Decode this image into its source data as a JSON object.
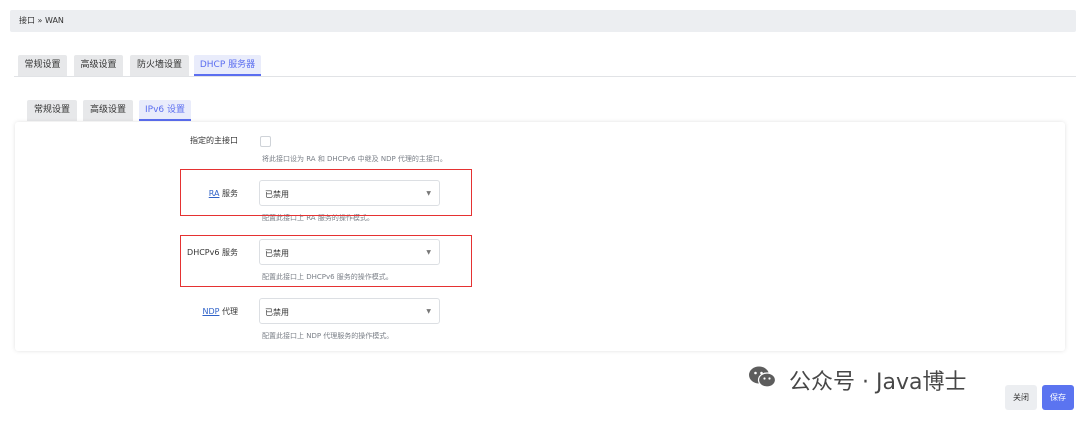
{
  "breadcrumb": "接口 » WAN",
  "main_tabs": [
    {
      "label": "常规设置",
      "active": false
    },
    {
      "label": "高级设置",
      "active": false
    },
    {
      "label": "防火墙设置",
      "active": false
    },
    {
      "label": "DHCP 服务器",
      "active": true
    }
  ],
  "sub_tabs": [
    {
      "label": "常规设置",
      "active": false
    },
    {
      "label": "高级设置",
      "active": false
    },
    {
      "label": "IPv6 设置",
      "active": true
    }
  ],
  "fields": {
    "master": {
      "label": "指定的主接口",
      "desc": "将此接口设为 RA 和 DHCPv6 中继及 NDP 代理的主接口。",
      "checked": false
    },
    "ra": {
      "label_abbr": "RA",
      "label_rest": " 服务",
      "value": "已禁用",
      "desc": "配置此接口上 RA 服务的操作模式。"
    },
    "dhcpv6": {
      "label": "DHCPv6 服务",
      "value": "已禁用",
      "desc": "配置此接口上 DHCPv6 服务的操作模式。"
    },
    "ndp": {
      "label_abbr": "NDP",
      "label_rest": " 代理",
      "value": "已禁用",
      "desc": "配置此接口上 NDP 代理服务的操作模式。"
    }
  },
  "watermark": "公众号 · Java博士",
  "buttons": {
    "close": "关闭",
    "save": "保存"
  },
  "colors": {
    "accent": "#5b6ef0",
    "highlight": "#e53232"
  }
}
